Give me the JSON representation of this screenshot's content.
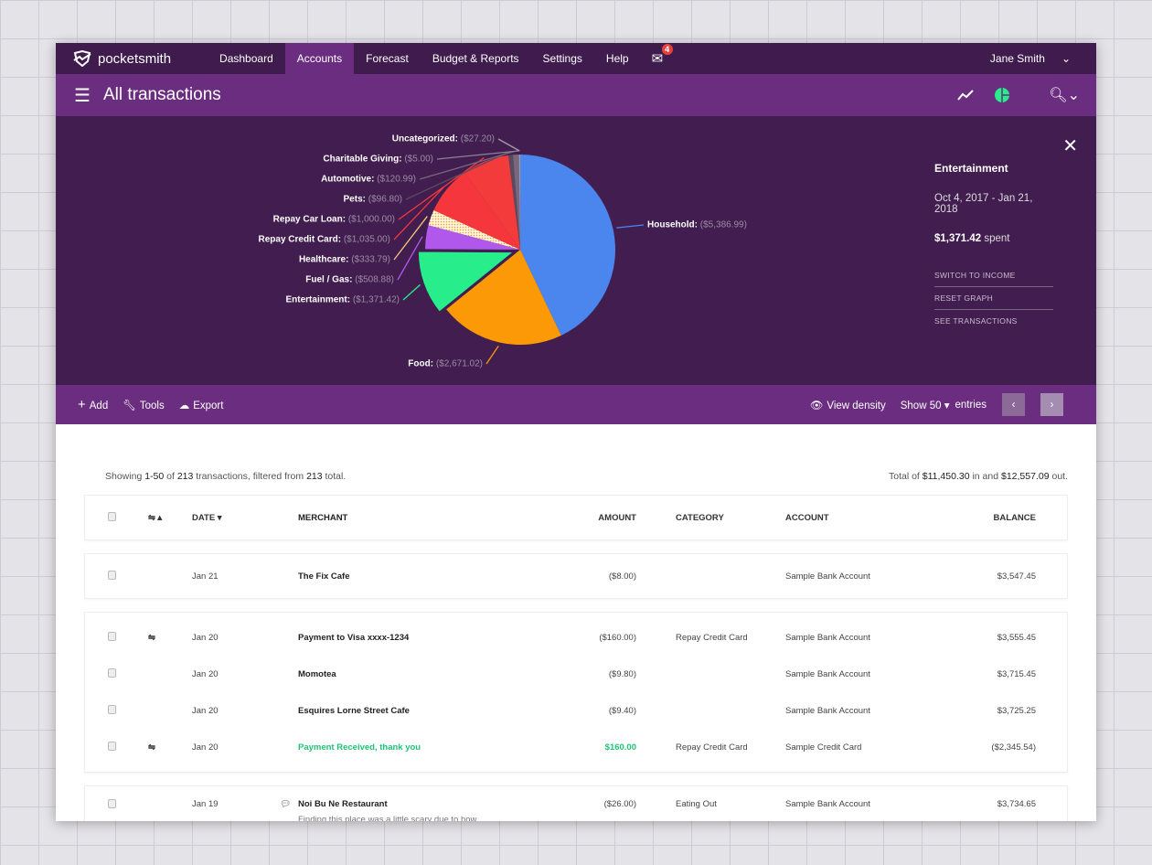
{
  "nav": {
    "brand": "pocketsmith",
    "items": [
      "Dashboard",
      "Accounts",
      "Forecast",
      "Budget & Reports",
      "Settings",
      "Help"
    ],
    "active": "Accounts",
    "mail_count": "4",
    "user": "Jane Smith"
  },
  "header": {
    "title": "All transactions"
  },
  "colors": {
    "nav": "#3f1b4e",
    "accent": "#6b2d80",
    "panel": "#421d50",
    "positive": "#1fc374"
  },
  "chart_data": {
    "type": "pie",
    "slices": [
      {
        "label": "Household:",
        "value": 5386.99,
        "display": "($5,386.99)",
        "color": "#4a86ee"
      },
      {
        "label": "Food:",
        "value": 2671.02,
        "display": "($2,671.02)",
        "color": "#fb9a06"
      },
      {
        "label": "Entertainment:",
        "value": 1371.42,
        "display": "($1,371.42)",
        "color": "#27ee8b",
        "exploded": true
      },
      {
        "label": "Fuel / Gas:",
        "value": 508.88,
        "display": "($508.88)",
        "color": "#b158ec"
      },
      {
        "label": "Healthcare:",
        "value": 333.79,
        "display": "($333.79)",
        "color": "#f3c97a",
        "pattern": "dotted"
      },
      {
        "label": "Repay Credit Card:",
        "value": 1035.0,
        "display": "($1,035.00)",
        "color": "#f5373d"
      },
      {
        "label": "Repay Car Loan:",
        "value": 1000.0,
        "display": "($1,000.00)",
        "color": "#f43b3b"
      },
      {
        "label": "Pets:",
        "value": 96.8,
        "display": "($96.80)",
        "color": "#5a4a60"
      },
      {
        "label": "Automotive:",
        "value": 120.99,
        "display": "($120.99)",
        "color": "#77687e"
      },
      {
        "label": "Charitable Giving:",
        "value": 5.0,
        "display": "($5.00)",
        "color": "#8e8294"
      },
      {
        "label": "Uncategorized:",
        "value": 27.2,
        "display": "($27.20)",
        "color": "#a49aa9"
      }
    ]
  },
  "detail": {
    "category": "Entertainment",
    "range": "Oct 4, 2017 - Jan 21, 2018",
    "amount": "$1,371.42",
    "amount_suffix": "spent",
    "links": [
      "SWITCH TO INCOME",
      "RESET GRAPH",
      "SEE TRANSACTIONS"
    ]
  },
  "toolbar": {
    "add": "Add",
    "tools": "Tools",
    "export": "Export",
    "density": "View density",
    "show": "Show 50",
    "entries": "entries"
  },
  "summary": {
    "p1": "Showing ",
    "range": "1-50",
    "p2": " of ",
    "count": "213",
    "p3": " transactions, filtered from ",
    "total": "213",
    "p4": " total.",
    "t1": "Total of ",
    "in": "$11,450.30",
    "t2": " in and ",
    "out": "$12,557.09",
    "t3": " out."
  },
  "table": {
    "headers": [
      "DATE",
      "MERCHANT",
      "AMOUNT",
      "CATEGORY",
      "ACCOUNT",
      "BALANCE"
    ],
    "groups": [
      [
        {
          "date": "Jan 21",
          "merchant": "The Fix Cafe",
          "amount": "($8.00)",
          "category": "",
          "account": "Sample Bank Account",
          "balance": "$3,547.45"
        }
      ],
      [
        {
          "transfer": true,
          "date": "Jan 20",
          "merchant": "Payment to Visa xxxx-1234",
          "amount": "($160.00)",
          "category": "Repay Credit Card",
          "account": "Sample Bank Account",
          "balance": "$3,555.45"
        },
        {
          "date": "Jan 20",
          "merchant": "Momotea",
          "amount": "($9.80)",
          "category": "",
          "account": "Sample Bank Account",
          "balance": "$3,715.45"
        },
        {
          "date": "Jan 20",
          "merchant": "Esquires Lorne Street Cafe",
          "amount": "($9.40)",
          "category": "",
          "account": "Sample Bank Account",
          "balance": "$3,725.25"
        },
        {
          "transfer": true,
          "positive": true,
          "date": "Jan 20",
          "merchant": "Payment Received, thank you",
          "amount": "$160.00",
          "category": "Repay Credit Card",
          "account": "Sample Credit Card",
          "balance": "($2,345.54)"
        }
      ],
      [
        {
          "note_icon": true,
          "date": "Jan 19",
          "merchant": "Noi Bu Ne Restaurant",
          "note": "Finding this place was a little scary due to how hidden it is. But service was prompt, prices are",
          "amount": "($26.00)",
          "category": "Eating Out",
          "account": "Sample Bank Account",
          "balance": "$3,734.65"
        }
      ]
    ]
  }
}
